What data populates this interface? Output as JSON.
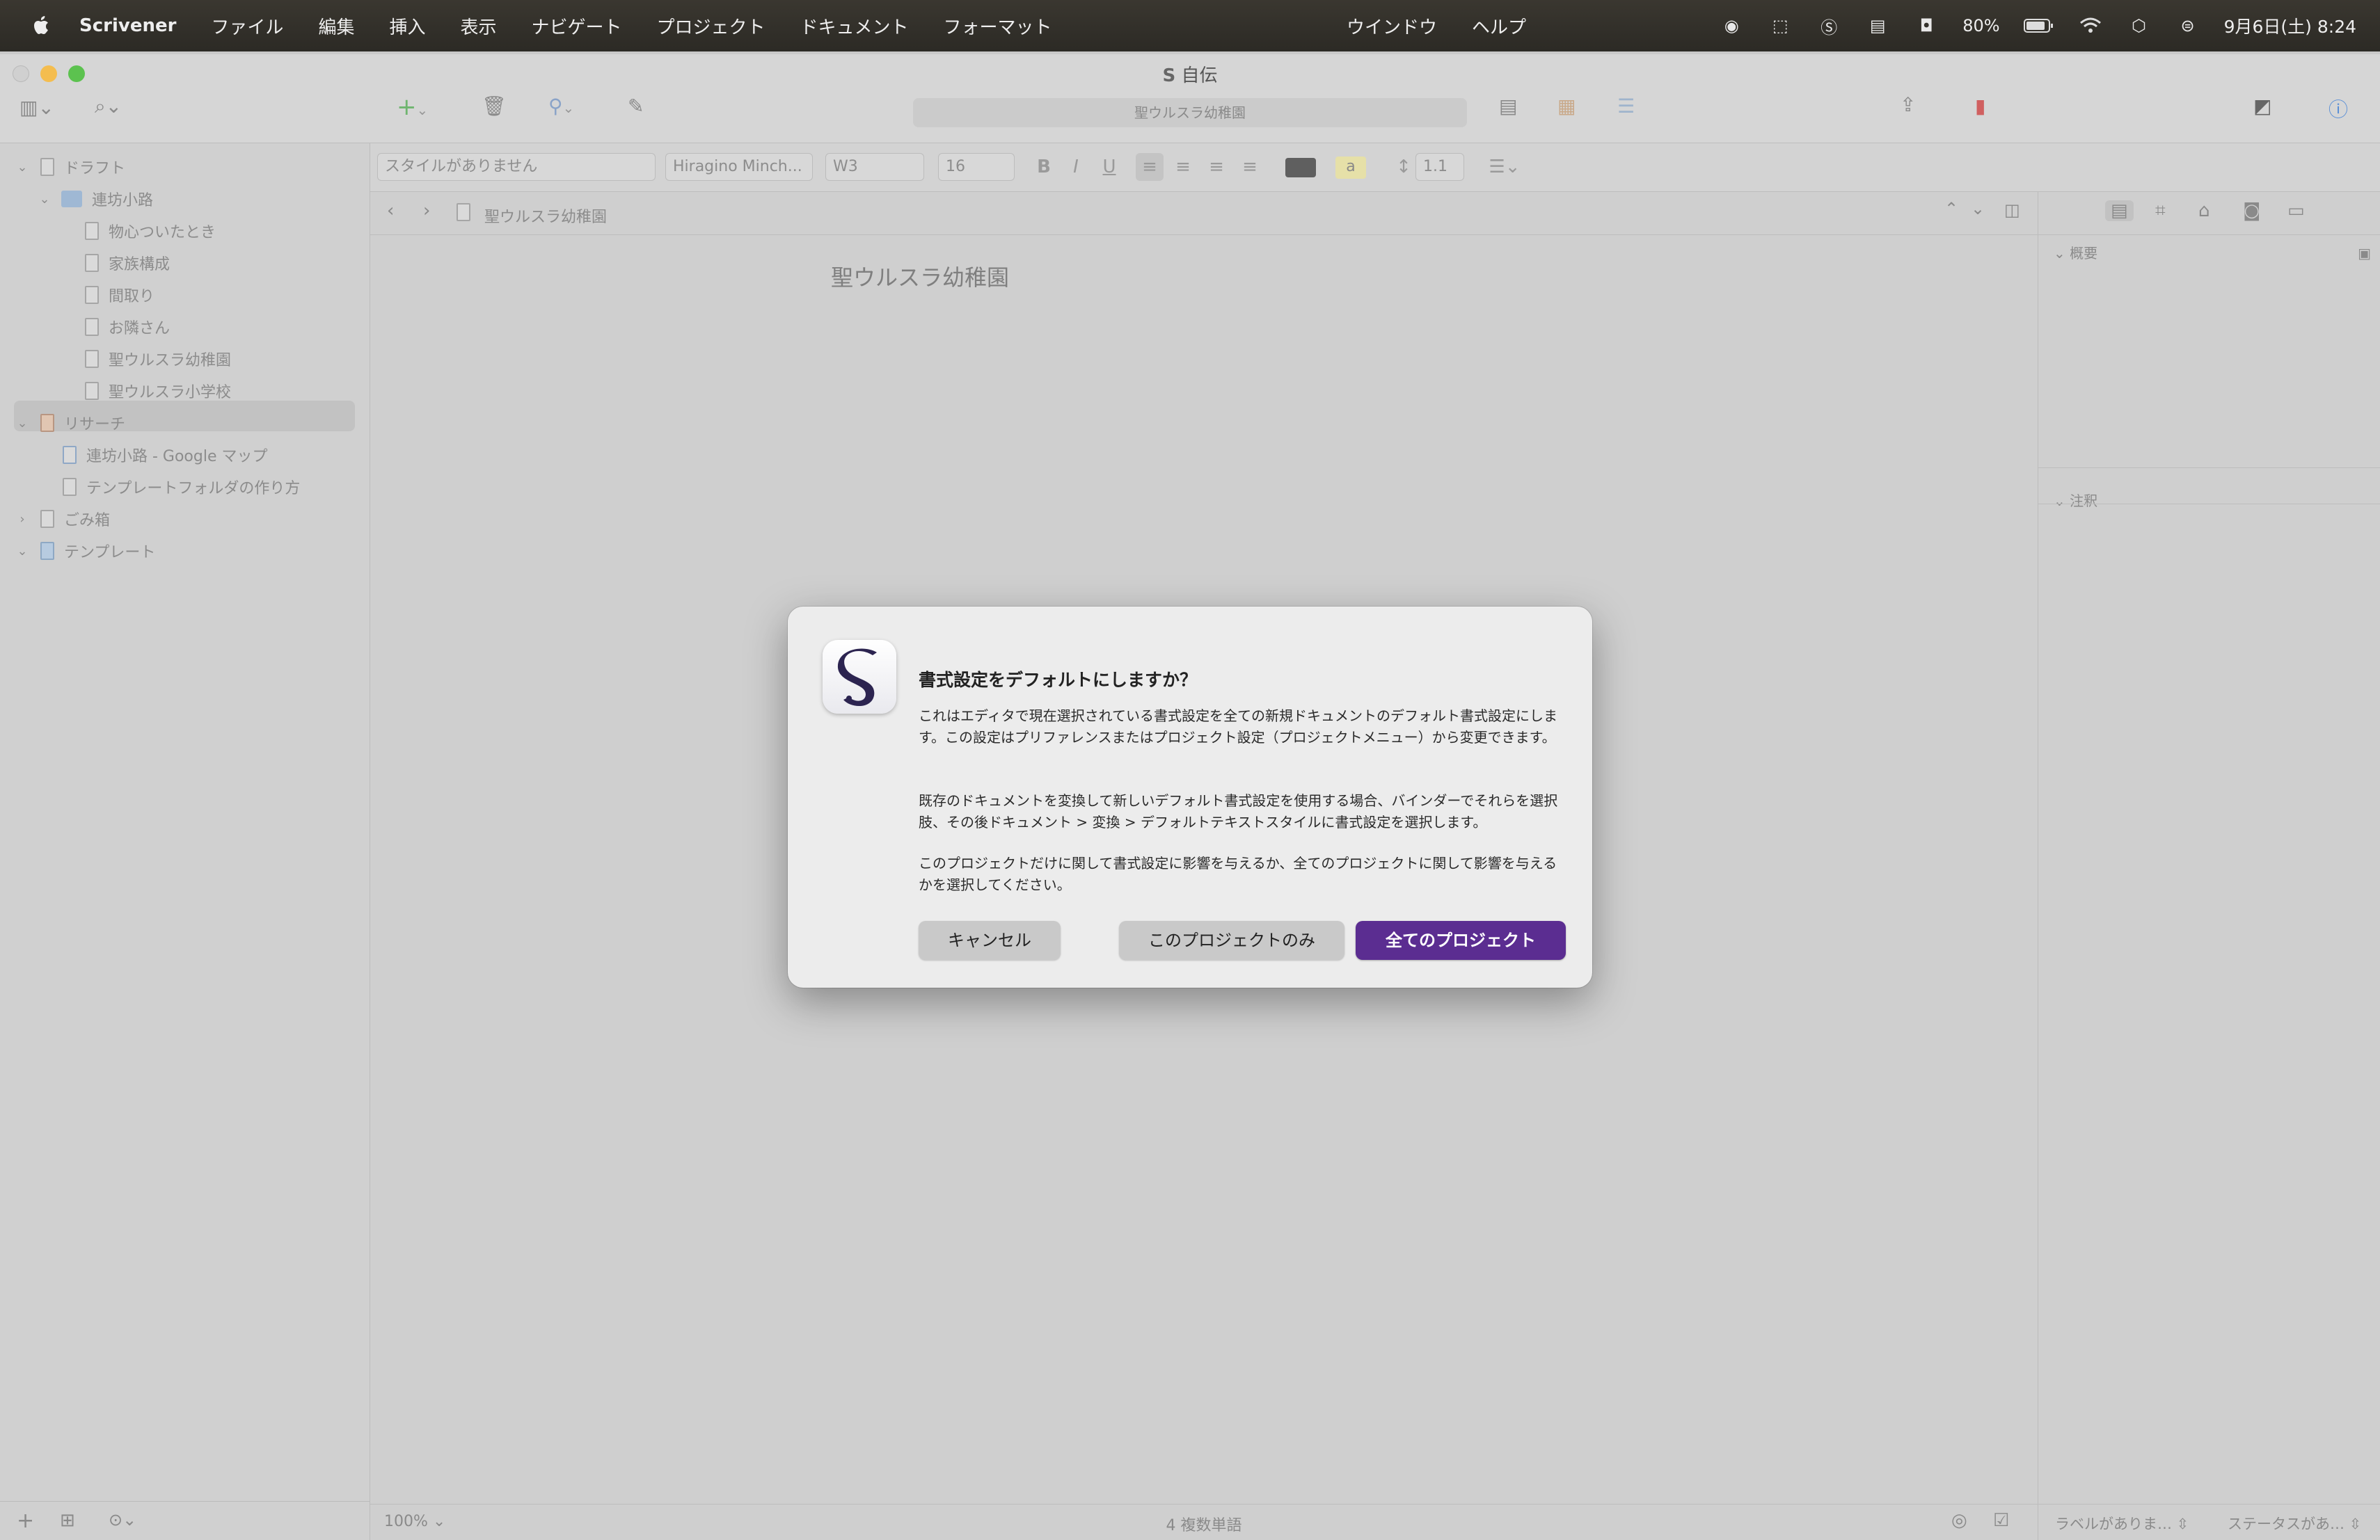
{
  "menubar": {
    "app": "Scrivener",
    "items": [
      "ファイル",
      "編集",
      "挿入",
      "表示",
      "ナビゲート",
      "プロジェクト",
      "ドキュメント",
      "フォーマット"
    ],
    "center_items": [
      "ウインドウ",
      "ヘルプ"
    ],
    "battery": "80%",
    "datetime": "9月6日(土) 8:24"
  },
  "window": {
    "title": "自伝",
    "document_title": "聖ウルスラ幼稚園"
  },
  "formatbar": {
    "style": "スタイルがありません",
    "font": "Hiragino Minch...",
    "weight": "W3",
    "size": "16",
    "bold": "B",
    "italic": "I",
    "underline": "U",
    "highlight": "a",
    "line_spacing": "1.1"
  },
  "binder": {
    "items": [
      {
        "label": "ドラフト"
      },
      {
        "label": "連坊小路"
      },
      {
        "label": "物心ついたとき"
      },
      {
        "label": "家族構成"
      },
      {
        "label": "間取り"
      },
      {
        "label": "お隣さん"
      },
      {
        "label": "聖ウルスラ幼稚園"
      },
      {
        "label": "聖ウルスラ小学校"
      },
      {
        "label": "リサーチ"
      },
      {
        "label": "連坊小路 - Google マップ"
      },
      {
        "label": "テンプレートフォルダの作り方"
      },
      {
        "label": "ごみ箱"
      },
      {
        "label": "テンプレート"
      }
    ]
  },
  "editor": {
    "breadcrumb": "聖ウルスラ幼稚園",
    "content": "聖ウルスラ幼稚園",
    "zoom": "100%",
    "word_count": "4 複数単語"
  },
  "inspector": {
    "synopsis_label": "概要",
    "notes_label": "注釈",
    "label_popup": "ラベルがありま…",
    "status_popup": "ステータスがあ…"
  },
  "dialog": {
    "title": "書式設定をデフォルトにしますか？",
    "para1": "これはエディタで現在選択されている書式設定を全ての新規ドキュメントのデフォルト書式設定にします。この設定はプリファレンスまたはプロジェクト設定（プロジェクトメニュー）から変更できます。",
    "para2": "既存のドキュメントを変換して新しいデフォルト書式設定を使用する場合、バインダーでそれらを選択肢、その後ドキュメント > 変換 > デフォルトテキストスタイルに書式設定を選択します。",
    "para3": "このプロジェクトだけに関して書式設定に影響を与えるか、全てのプロジェクトに関して影響を与えるかを選択してください。",
    "cancel": "キャンセル",
    "this_project": "このプロジェクトのみ",
    "all_projects": "全てのプロジェクト"
  },
  "colors": {
    "accent": "#5b2d91",
    "close": "#ff5f57",
    "minimize": "#febc2e",
    "zoom": "#28c840"
  }
}
